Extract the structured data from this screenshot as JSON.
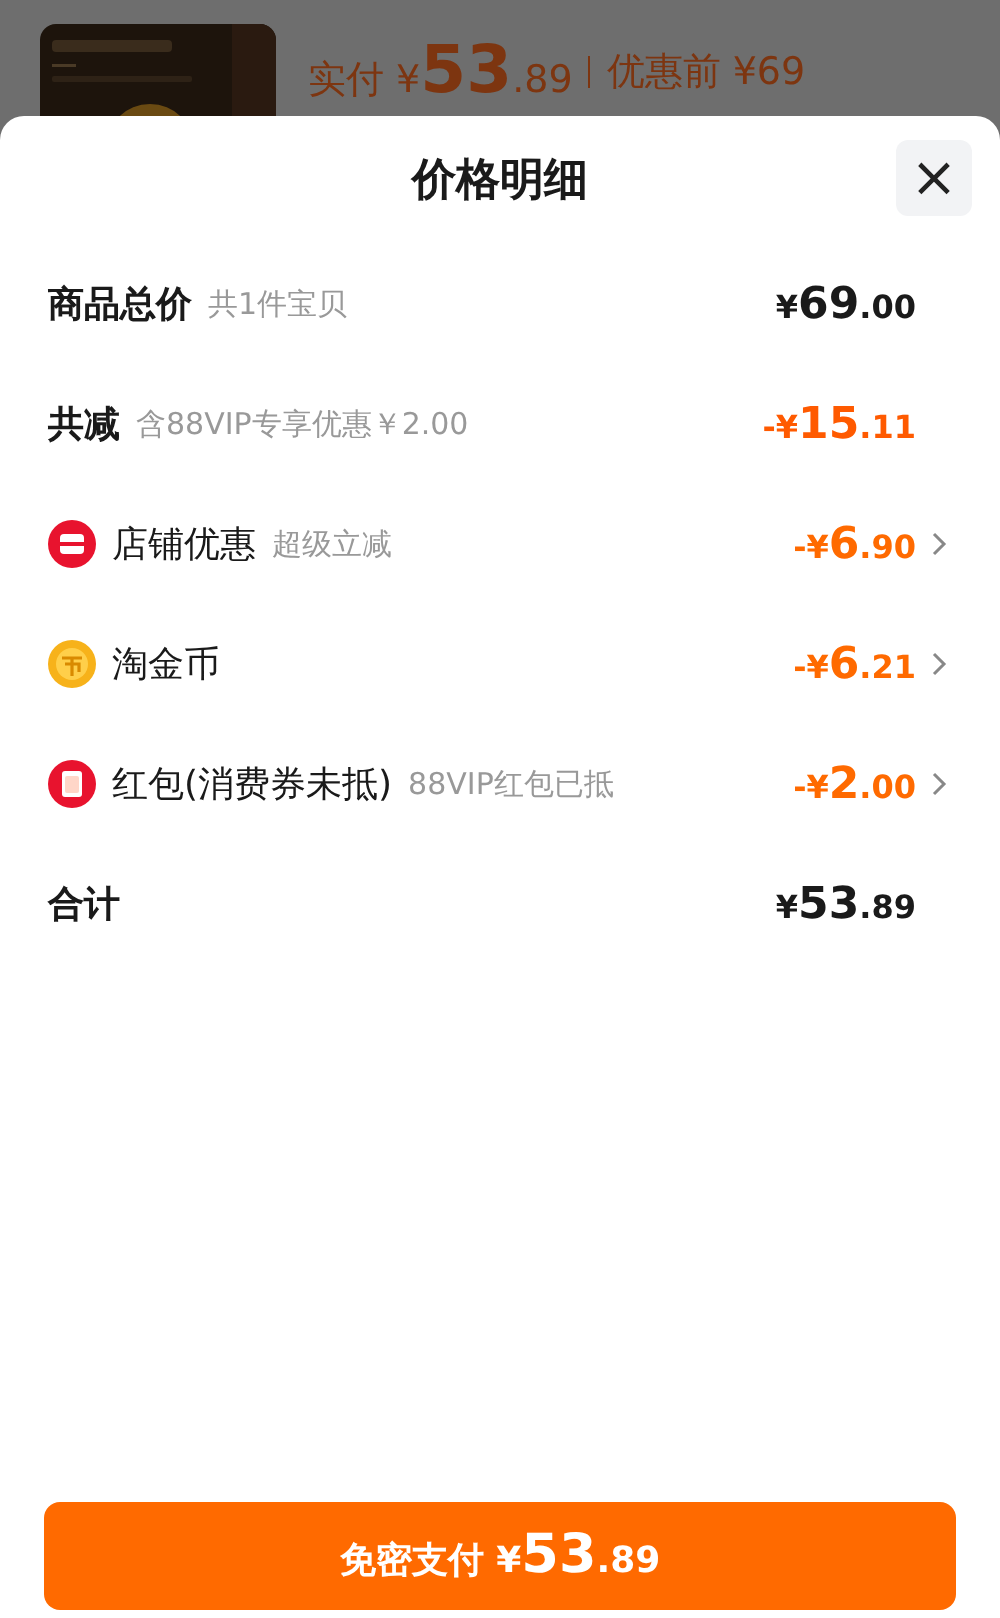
{
  "background_order": {
    "paid_label": "实付",
    "paid_currency": "¥",
    "paid_main": "53",
    "paid_fraction": ".89",
    "original_label": "优惠前",
    "original_price": "¥69"
  },
  "sheet": {
    "title": "价格明细",
    "close": "×",
    "rows": [
      {
        "kind": "total",
        "label": "商品总价",
        "note": "共1件宝贝",
        "prefix": "¥",
        "main": "69",
        "fraction": ".00"
      },
      {
        "kind": "discount",
        "label": "共减",
        "note": "含88VIP专享优惠￥2.00",
        "prefix": "-¥",
        "main": "15",
        "fraction": ".11"
      },
      {
        "kind": "detail",
        "label": "店铺优惠",
        "note": "超级立减",
        "prefix": "-¥",
        "main": "6",
        "fraction": ".90",
        "expandable": true
      },
      {
        "kind": "detail",
        "label": "淘金币",
        "prefix": "-¥",
        "main": "6",
        "fraction": ".21",
        "expandable": true
      },
      {
        "kind": "detail",
        "label": "红包(消费券未抵)",
        "note": "88VIP红包已抵",
        "prefix": "-¥",
        "main": "2",
        "fraction": ".00",
        "expandable": true
      },
      {
        "kind": "sum",
        "label": "合计",
        "prefix": "¥",
        "main": "53",
        "fraction": ".89"
      }
    ],
    "pay_button": {
      "label": "免密支付",
      "prefix": "¥",
      "main": "53",
      "fraction": ".89"
    }
  }
}
